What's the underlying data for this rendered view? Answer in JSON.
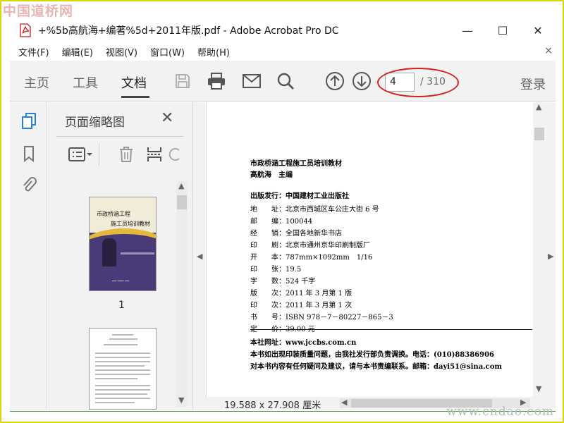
{
  "watermark": {
    "top": "中国道桥网",
    "bottom": "www.cndao.com"
  },
  "window": {
    "title": "+%5b高航海+编著%5d+2011年版.pdf - Adobe Acrobat Pro DC",
    "minimize": "—",
    "maximize": "☐",
    "close": "✕"
  },
  "menu": {
    "items": [
      "文件(F)",
      "编辑(E)",
      "视图(V)",
      "窗口(W)",
      "帮助(H)"
    ],
    "close": "×"
  },
  "toolbar": {
    "tabs": [
      "主页",
      "工具",
      "文档"
    ],
    "active_tab": "文档",
    "page_current": "4",
    "page_total": "/ 310",
    "login": "登录",
    "accent_color": "#d62020"
  },
  "panel": {
    "title": "页面缩略图",
    "close": "✕",
    "thumb1_label": "1",
    "cover_title_line1": "市政桥涵工程",
    "cover_title_line2": "施工员培训教材"
  },
  "document": {
    "lines": [
      "市政桥涵工程施工员培训教材",
      "高航海　主编",
      "出版发行：中国建材工业出版社",
      "地　　址：北京市西城区车公庄大街 6 号",
      "邮　　编：100044",
      "经　　销：全国各地新华书店",
      "印　　刷：北京市通州京华印刷制版厂",
      "开　　本：787mm×1092mm　1/16",
      "印　　张：19.5",
      "字　　数：524 千字",
      "版　　次：2011 年 3 月第 1 版",
      "印　　次：2011 年 3 月第 1 次",
      "书　　号：ISBN 978－7－80227－865－3",
      "定　　价：39.00 元"
    ],
    "footer_lines": [
      "本社网址：www.jccbs.com.cn",
      "本书如出现印装质量问题，由我社发行部负责调换。电话：(010)88386906",
      "对本书内容有任何疑问及建议，请与本书责编联系。邮箱：dayi51@sina.com"
    ]
  },
  "status": {
    "page_size": "19.588 x 27.908 厘米"
  }
}
